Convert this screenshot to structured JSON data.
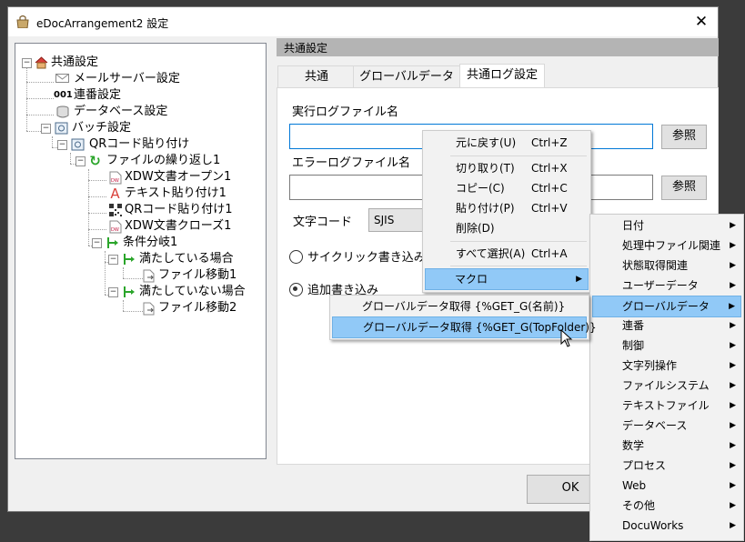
{
  "window": {
    "title": "eDocArrangement2 設定",
    "close_glyph": "✕"
  },
  "tree": {
    "root": "共通設定",
    "items": [
      {
        "label": "メールサーバー設定"
      },
      {
        "label": "連番設定",
        "icon_text": "001"
      },
      {
        "label": "データベース設定"
      },
      {
        "label": "バッチ設定"
      },
      {
        "label": "QRコード貼り付け"
      },
      {
        "label": "ファイルの繰り返し1"
      },
      {
        "label": "XDW文書オープン1"
      },
      {
        "label": "テキスト貼り付け1"
      },
      {
        "label": "QRコード貼り付け1"
      },
      {
        "label": "XDW文書クローズ1"
      },
      {
        "label": "条件分岐1"
      },
      {
        "label": "満たしている場合"
      },
      {
        "label": "ファイル移動1"
      },
      {
        "label": "満たしていない場合"
      },
      {
        "label": "ファイル移動2"
      }
    ]
  },
  "section_header": "共通設定",
  "tabs": [
    {
      "label": "共通"
    },
    {
      "label": "グローバルデータ"
    },
    {
      "label": "共通ログ設定"
    }
  ],
  "form": {
    "exec_log_label": "実行ログファイル名",
    "error_log_label": "エラーログファイル名",
    "browse_label": "参照",
    "encoding_label": "文字コード",
    "encoding_value": "SJIS",
    "cyclic_label": "サイクリック書き込み",
    "append_label": "追加書き込み",
    "ok_label": "OK"
  },
  "context_menu": {
    "items": [
      {
        "label": "元に戻す(U)",
        "shortcut": "Ctrl+Z"
      },
      {
        "label": "切り取り(T)",
        "shortcut": "Ctrl+X"
      },
      {
        "label": "コピー(C)",
        "shortcut": "Ctrl+C"
      },
      {
        "label": "貼り付け(P)",
        "shortcut": "Ctrl+V"
      },
      {
        "label": "削除(D)",
        "shortcut": ""
      },
      {
        "label": "すべて選択(A)",
        "shortcut": "Ctrl+A"
      },
      {
        "label": "マクロ",
        "shortcut": ""
      }
    ]
  },
  "macro_menu": {
    "items": [
      "日付",
      "処理中ファイル関連",
      "状態取得関連",
      "ユーザーデータ",
      "グローバルデータ",
      "連番",
      "制御",
      "文字列操作",
      "ファイルシステム",
      "テキストファイル",
      "データベース",
      "数学",
      "プロセス",
      "Web",
      "その他",
      "DocuWorks"
    ]
  },
  "global_menu": {
    "items": [
      "グローバルデータ取得 {%GET_G(名前)}",
      "グローバルデータ取得 {%GET_G(TopFolder)}"
    ]
  },
  "colors": {
    "highlight": "#91c9f7",
    "section_header": "#b4b4b4",
    "accent_green": "#2aa52a",
    "doc_red": "#c0143c"
  }
}
